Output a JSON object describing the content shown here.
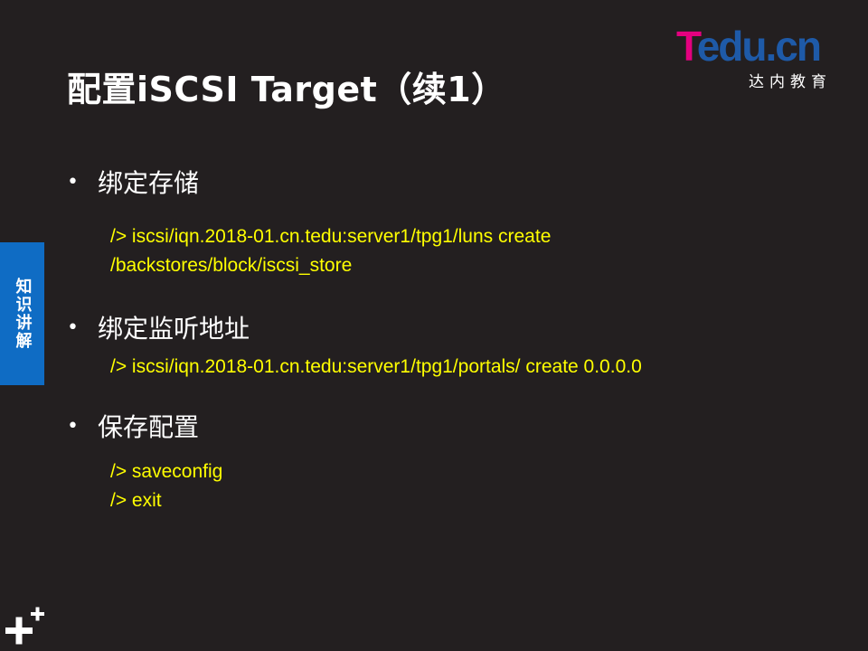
{
  "slide": {
    "title": "配置iSCSI Target（续1）",
    "logo": {
      "brand_t": "T",
      "brand_rest": "edu.cn",
      "subtitle": "达内教育"
    },
    "side_tab": "知识讲解",
    "sections": [
      {
        "bullet": "绑定存储",
        "commands": [
          "/> iscsi/iqn.2018-01.cn.tedu:server1/tpg1/luns create",
          "/backstores/block/iscsi_store"
        ]
      },
      {
        "bullet": "绑定监听地址",
        "commands": [
          "/> iscsi/iqn.2018-01.cn.tedu:server1/tpg1/portals/ create 0.0.0.0"
        ]
      },
      {
        "bullet": "保存配置",
        "commands": [
          "/> saveconfig",
          "/> exit"
        ]
      }
    ],
    "colors": {
      "background": "#231f20",
      "command_text": "#ffff00",
      "side_tab": "#0f6cc4",
      "logo_pink": "#e4007f",
      "logo_blue": "#1e5aa8"
    },
    "corner_icon": "plus-icon"
  }
}
